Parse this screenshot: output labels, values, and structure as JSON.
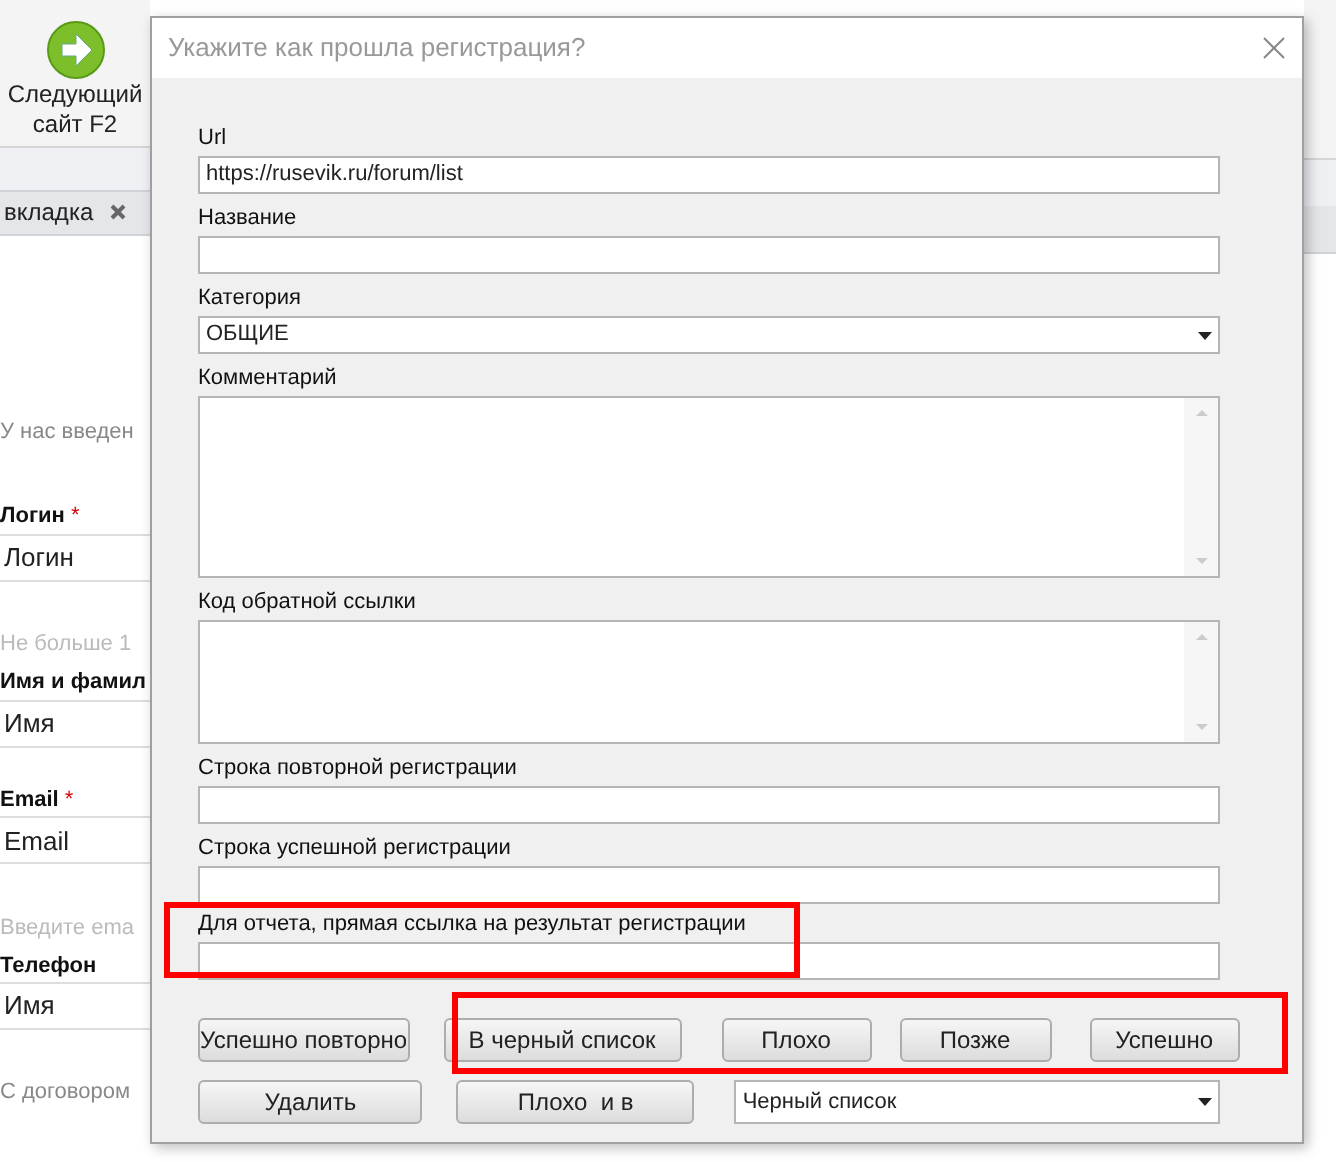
{
  "toolbar_button": {
    "lines": [
      "Следующий",
      "сайт F2"
    ]
  },
  "tab": {
    "label": "вкладка"
  },
  "form": [
    {
      "kind": "text",
      "text": "У нас введен"
    },
    {
      "kind": "label",
      "text": "Логин",
      "required_mark": "*"
    },
    {
      "kind": "input",
      "value": "Логин"
    },
    {
      "kind": "hint",
      "text": "Не больше 1"
    },
    {
      "kind": "label",
      "text": "Имя и фамил"
    },
    {
      "kind": "input",
      "value": "Имя"
    },
    {
      "kind": "label",
      "text": "Email",
      "required_mark": "*"
    },
    {
      "kind": "input",
      "value": "Email"
    },
    {
      "kind": "hint",
      "text": "Введите ema"
    },
    {
      "kind": "label",
      "text": "Телефон"
    },
    {
      "kind": "input",
      "value": "Имя"
    },
    {
      "kind": "text",
      "text": "С договором"
    }
  ],
  "dialog": {
    "title": "Укажите как прошла регистрация?",
    "fields": [
      {
        "kind": "text",
        "label": "Url",
        "value": "https://rusevik.ru/forum/list",
        "highlighted": false
      },
      {
        "kind": "text",
        "label": "Название",
        "highlighted": false
      },
      {
        "kind": "select",
        "label": "Категория",
        "value": "ОБЩИЕ",
        "highlighted": false
      },
      {
        "kind": "textarea",
        "label": "Комментарий",
        "highlighted": false
      },
      {
        "kind": "textarea",
        "label": "Код обратной ссылки",
        "highlighted": false
      },
      {
        "kind": "text",
        "label": "Строка повторной регистрации",
        "highlighted": false
      },
      {
        "kind": "text",
        "label": "Строка успешной регистрации",
        "highlighted": false
      },
      {
        "kind": "text",
        "label": "Для отчета, прямая ссылка на результат регистрации",
        "highlighted": true
      }
    ],
    "row1": {
      "first": "Успешно повторно",
      "group": [
        "В черный список",
        "Плохо",
        "Позже",
        "Успешно"
      ],
      "group_highlighted": true
    },
    "row2": {
      "buttons": [
        "Удалить",
        "Плохо  и в"
      ],
      "select": "Черный список"
    }
  }
}
